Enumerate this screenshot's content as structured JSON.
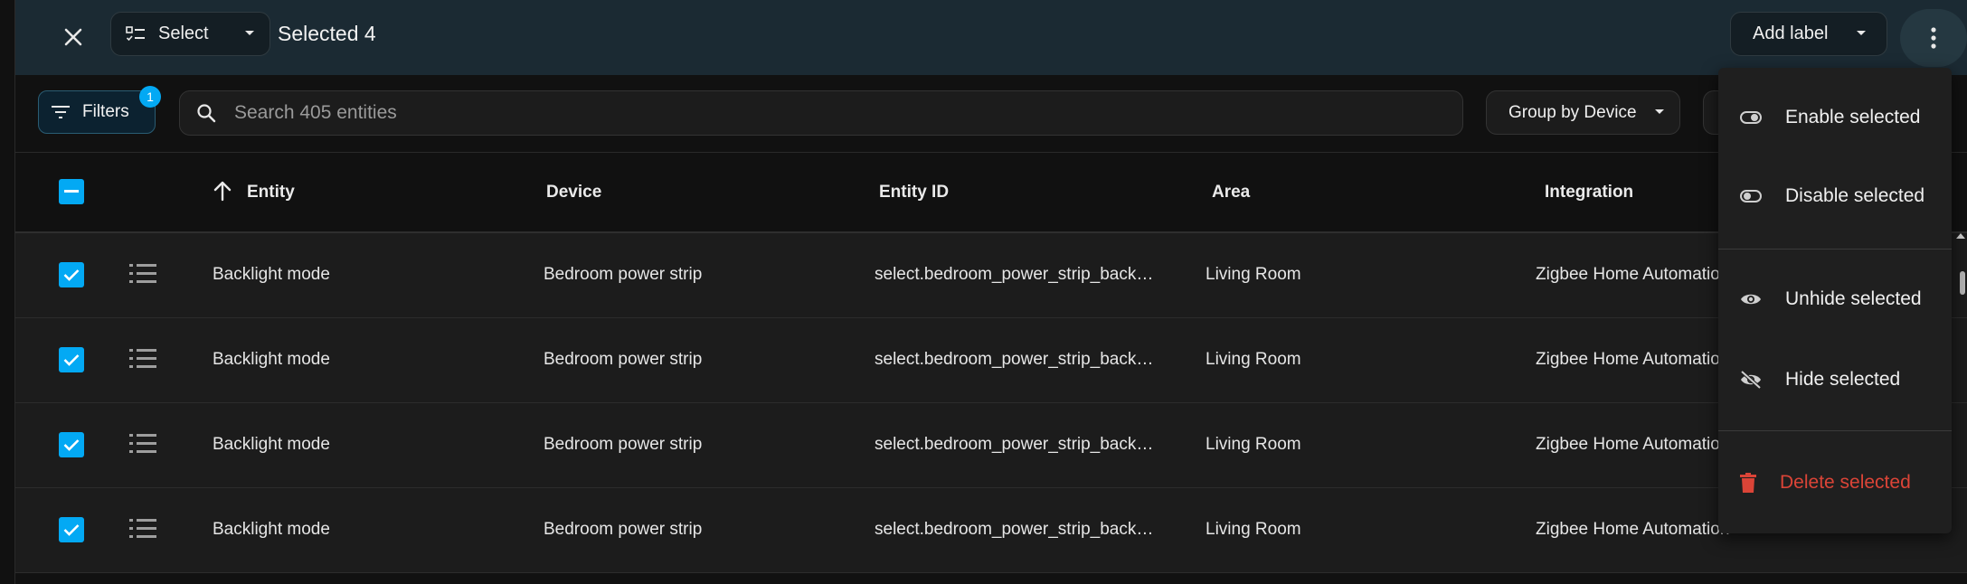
{
  "toolbar": {
    "select_label": "Select",
    "selected_text": "Selected 4",
    "add_label": "Add label"
  },
  "filters": {
    "label": "Filters",
    "badge_count": "1"
  },
  "search": {
    "placeholder": "Search 405 entities",
    "value": ""
  },
  "group_by": {
    "label": "Group by Device"
  },
  "table": {
    "columns": {
      "entity": "Entity",
      "device": "Device",
      "entity_id": "Entity ID",
      "area": "Area",
      "integration": "Integration"
    },
    "sort": {
      "column": "Entity",
      "direction": "ascending"
    },
    "rows": [
      {
        "entity": "Backlight mode",
        "device": "Bedroom power strip",
        "entity_id": "select.bedroom_power_strip_back…",
        "area": "Living Room",
        "integration": "Zigbee Home Automation",
        "selected": true
      },
      {
        "entity": "Backlight mode",
        "device": "Bedroom power strip",
        "entity_id": "select.bedroom_power_strip_back…",
        "area": "Living Room",
        "integration": "Zigbee Home Automation",
        "selected": true
      },
      {
        "entity": "Backlight mode",
        "device": "Bedroom power strip",
        "entity_id": "select.bedroom_power_strip_back…",
        "area": "Living Room",
        "integration": "Zigbee Home Automation",
        "selected": true
      },
      {
        "entity": "Backlight mode",
        "device": "Bedroom power strip",
        "entity_id": "select.bedroom_power_strip_back…",
        "area": "Living Room",
        "integration": "Zigbee Home Automation",
        "selected": true
      }
    ]
  },
  "menu": {
    "items": [
      {
        "label": "Enable selected",
        "icon": "toggle-switch-icon"
      },
      {
        "label": "Disable selected",
        "icon": "toggle-switch-off-icon"
      },
      {
        "label": "Unhide selected",
        "icon": "eye-icon"
      },
      {
        "label": "Hide selected",
        "icon": "eye-off-icon"
      },
      {
        "label": "Delete selected",
        "icon": "trash-icon"
      }
    ]
  },
  "colors": {
    "accent": "#03a9f4",
    "topbar_bg": "#1b2a33",
    "danger": "#db4437",
    "row_bg": "#1c1c1c"
  }
}
